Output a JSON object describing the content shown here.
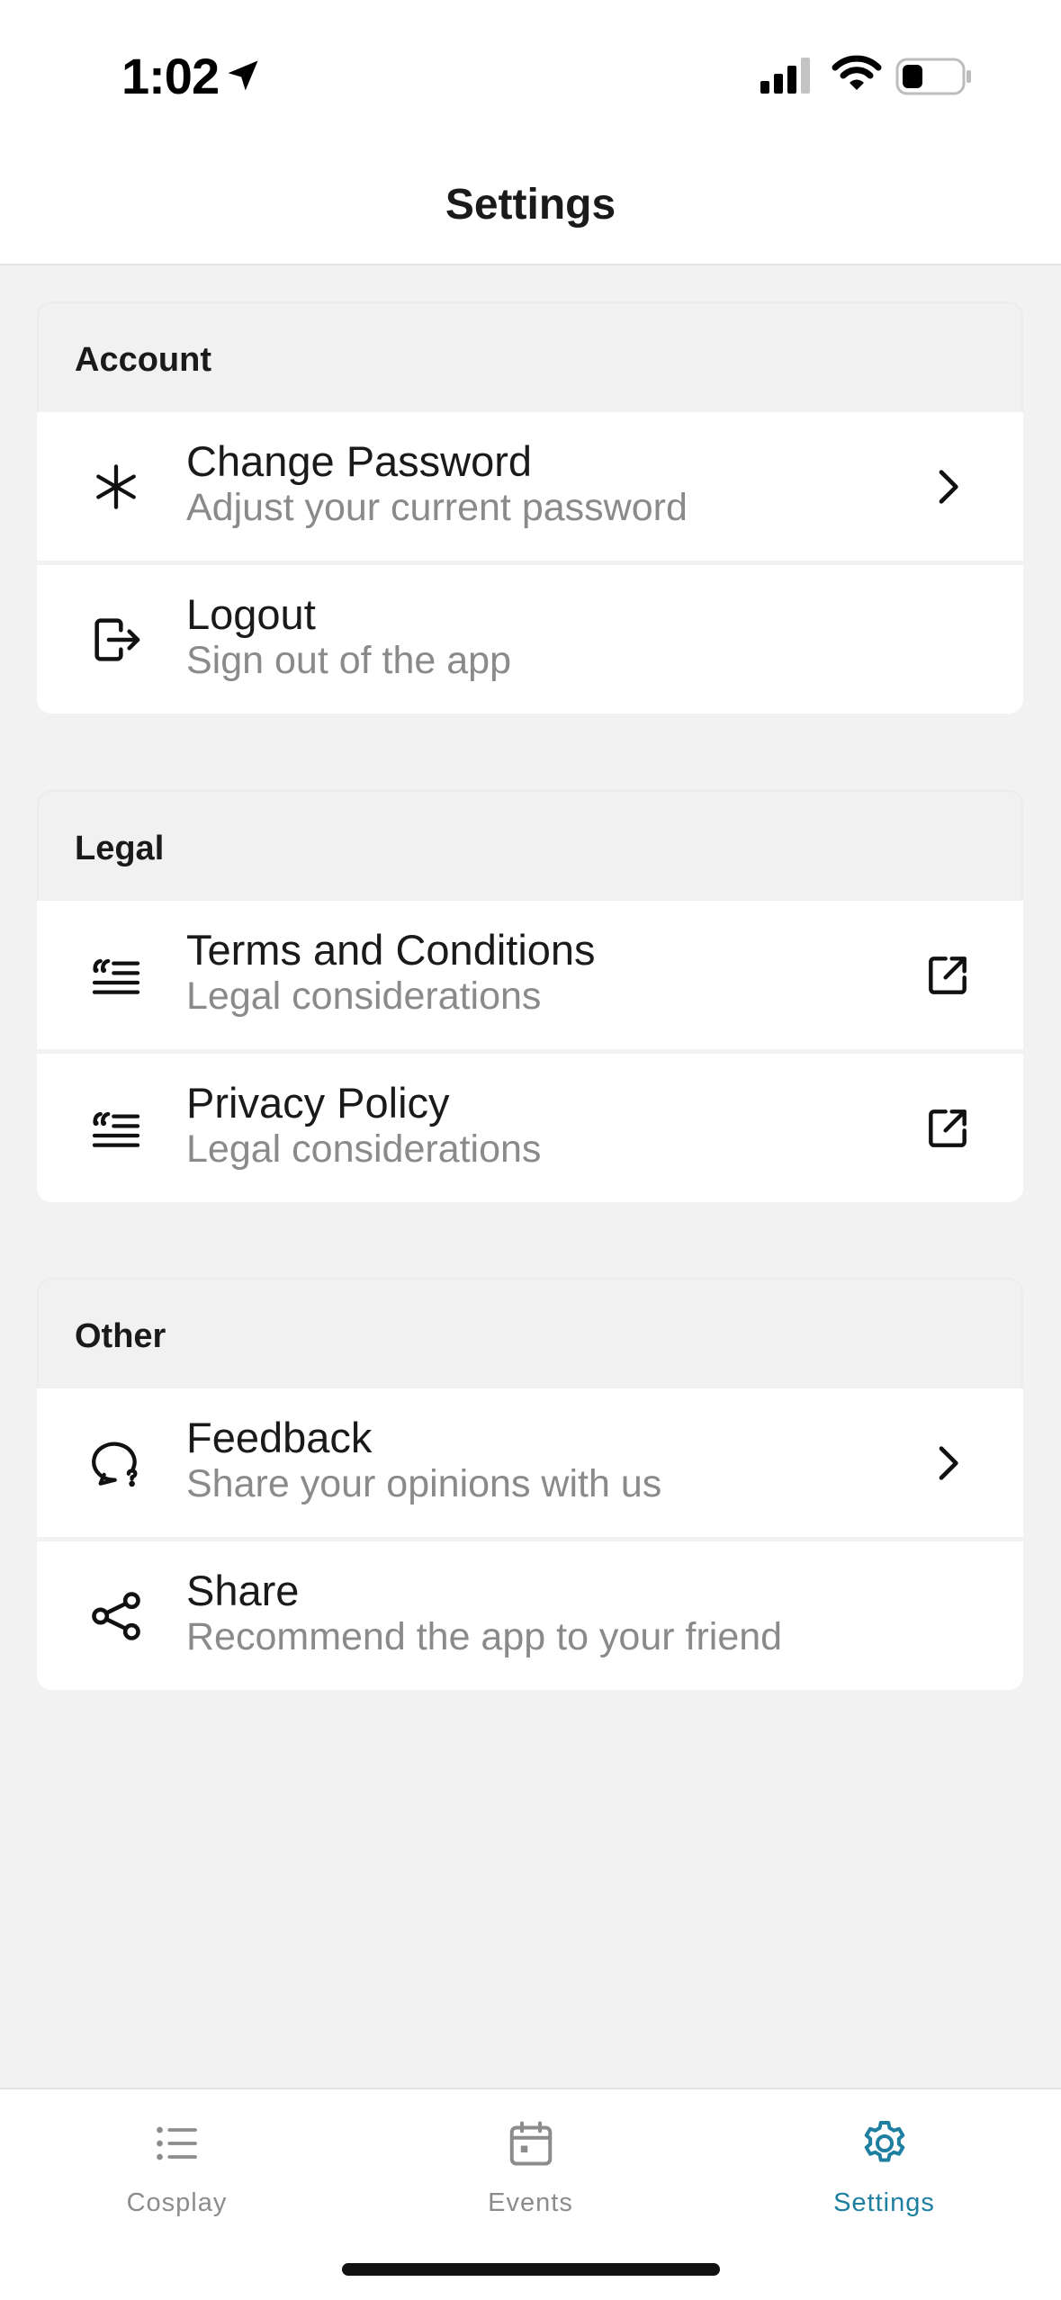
{
  "status_bar": {
    "time": "1:02"
  },
  "header": {
    "title": "Settings"
  },
  "sections": [
    {
      "title": "Account",
      "items": [
        {
          "title": "Change Password",
          "subtitle": "Adjust your current password",
          "icon": "asterisk-icon",
          "action": "chevron-right-icon"
        },
        {
          "title": "Logout",
          "subtitle": "Sign out of the app",
          "icon": "logout-icon",
          "action": ""
        }
      ]
    },
    {
      "title": "Legal",
      "items": [
        {
          "title": "Terms and Conditions",
          "subtitle": "Legal considerations",
          "icon": "quote-text-icon",
          "action": "external-link-icon"
        },
        {
          "title": "Privacy Policy",
          "subtitle": "Legal considerations",
          "icon": "quote-text-icon",
          "action": "external-link-icon"
        }
      ]
    },
    {
      "title": "Other",
      "items": [
        {
          "title": "Feedback",
          "subtitle": "Share your opinions with us",
          "icon": "message-question-icon",
          "action": "chevron-right-icon"
        },
        {
          "title": "Share",
          "subtitle": "Recommend the app to your friend",
          "icon": "share-icon",
          "action": ""
        }
      ]
    }
  ],
  "tab_bar": {
    "tabs": [
      {
        "label": "Cosplay",
        "icon": "list-icon",
        "active": false
      },
      {
        "label": "Events",
        "icon": "calendar-icon",
        "active": false
      },
      {
        "label": "Settings",
        "icon": "gear-icon",
        "active": true
      }
    ]
  },
  "colors": {
    "accent": "#1e7fa0",
    "background": "#f2f2f2",
    "card": "#ffffff",
    "subtitle": "#8a8a8a",
    "inactive_tab": "#8c8c8c"
  }
}
